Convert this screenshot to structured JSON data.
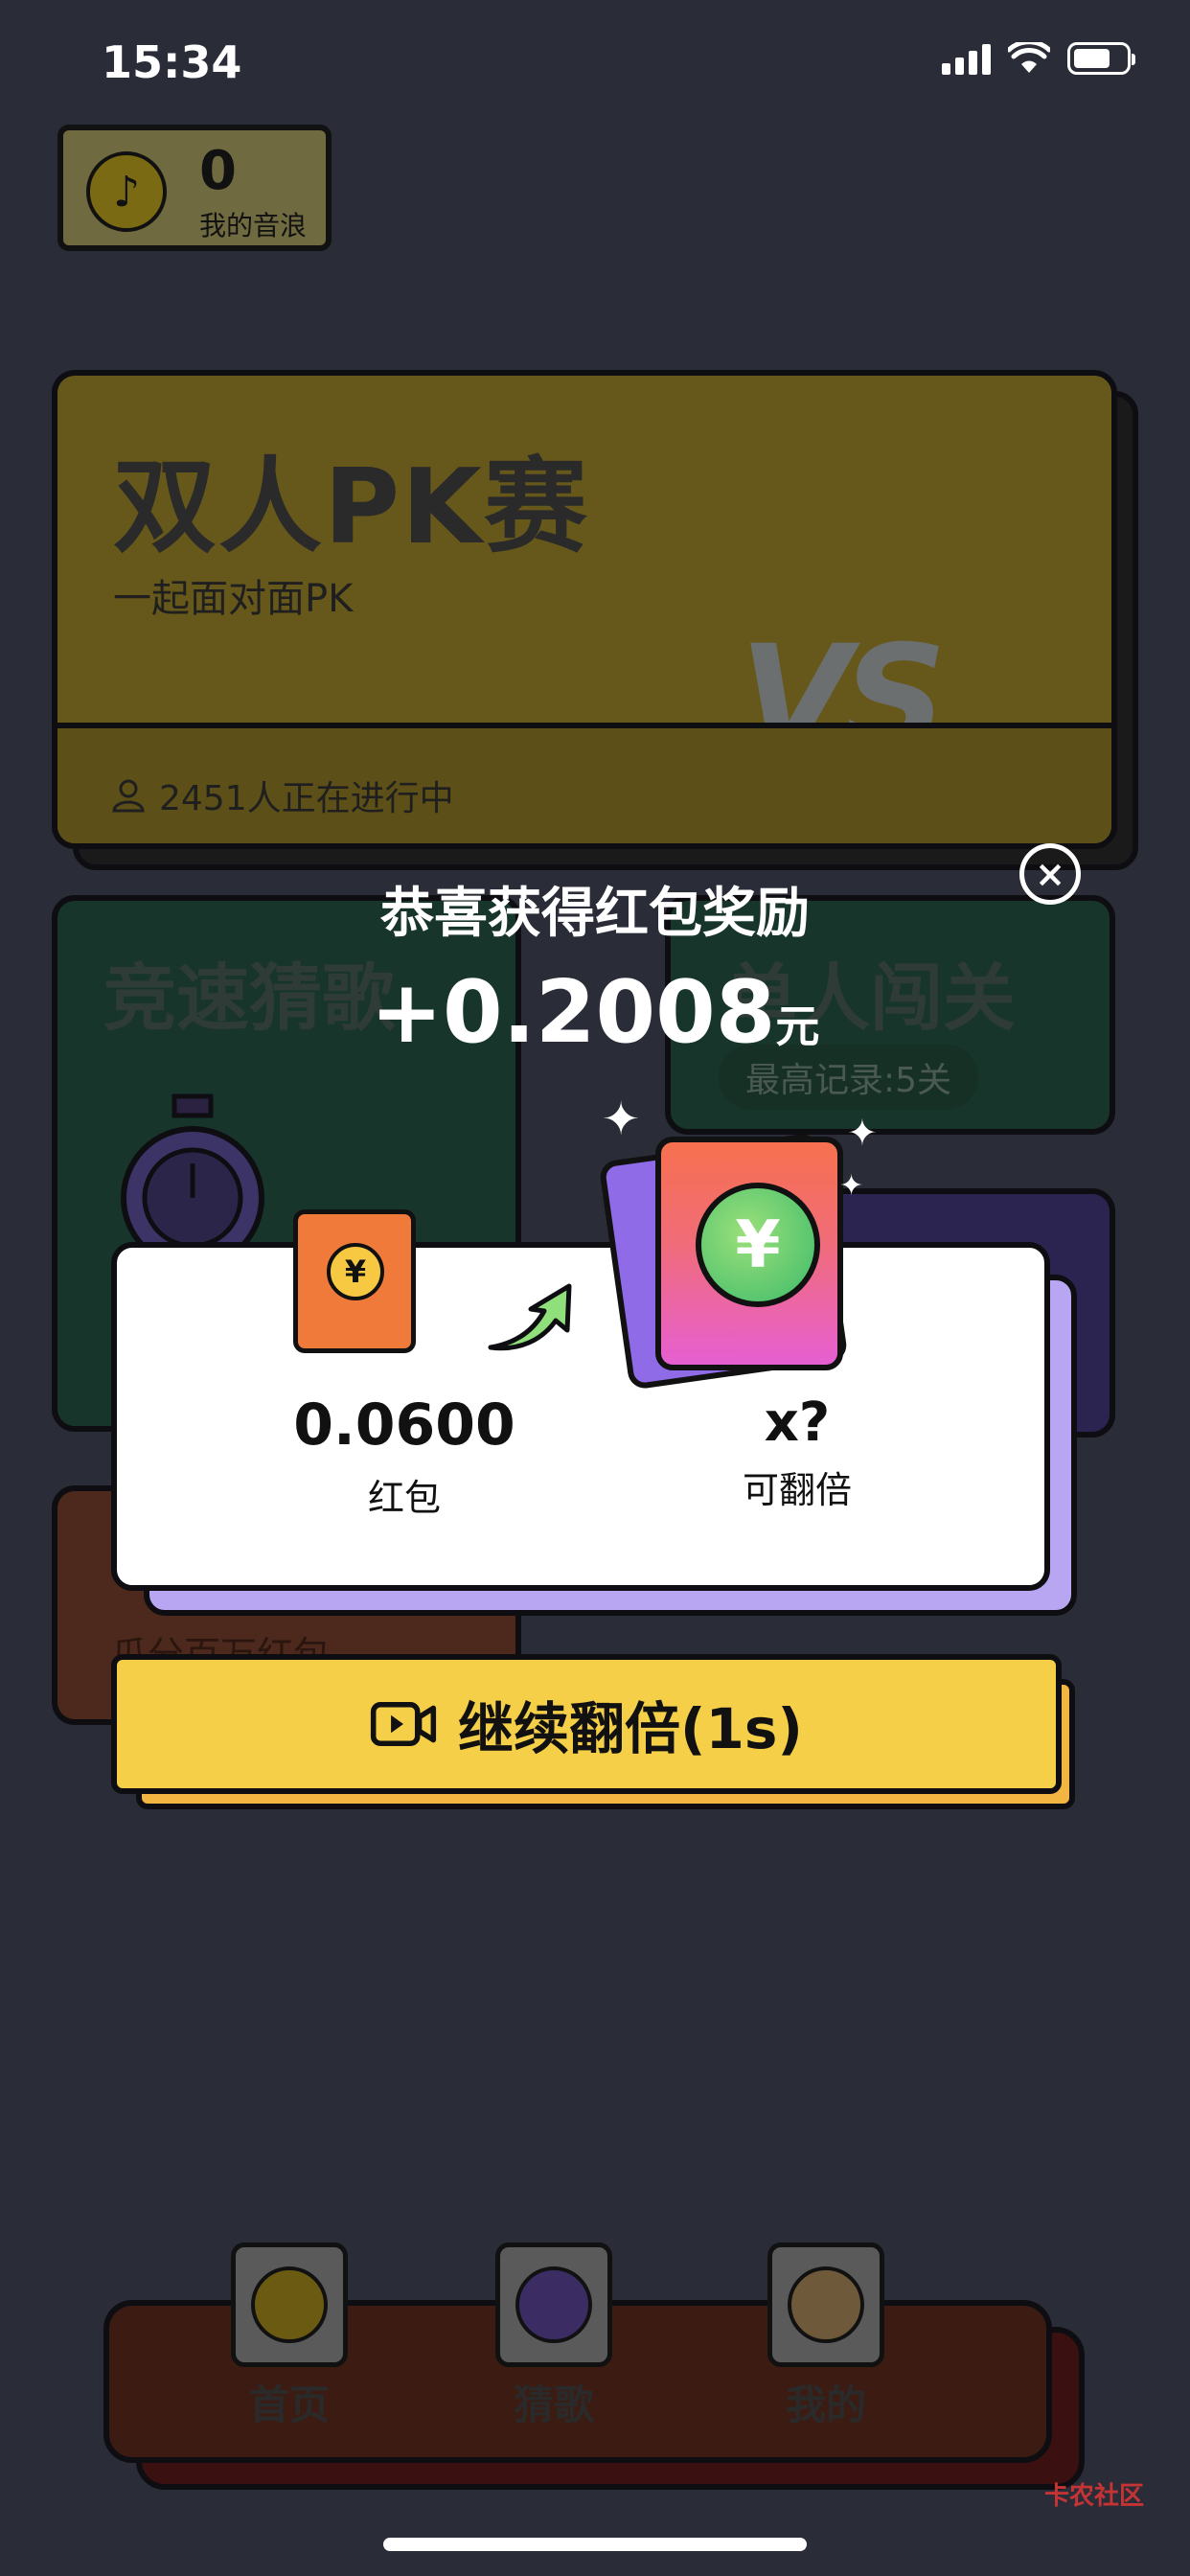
{
  "status_bar": {
    "time": "15:34"
  },
  "wallet": {
    "count": "0",
    "label": "我的音浪"
  },
  "cards": {
    "pk": {
      "title": "双人PK赛",
      "subtitle": "一起面对面PK",
      "users": "2451人正在进行中",
      "vs": "VS"
    },
    "speed": {
      "title": "竞速猜歌"
    },
    "single": {
      "title": "单人闯关",
      "record": "最高记录:5关"
    },
    "red": {
      "subtitle": "瓜分百万红包"
    }
  },
  "modal": {
    "title": "恭喜获得红包奖励",
    "amount": "+0.2008",
    "unit": "元",
    "red_packet_value": "0.0600",
    "red_packet_label": "红包",
    "multiplier": "x?",
    "multiplier_label": "可翻倍",
    "coin_symbol": "¥",
    "close_symbol": "×"
  },
  "cta": {
    "label": "继续翻倍(1s)"
  },
  "nav": [
    {
      "label": "首页"
    },
    {
      "label": "猜歌"
    },
    {
      "label": "我的"
    }
  ],
  "watermark": "卡农社区",
  "colors": {
    "cta": "#f6cf49",
    "panel_shadow": "#b9a6f2",
    "background": "#2a2c38"
  }
}
